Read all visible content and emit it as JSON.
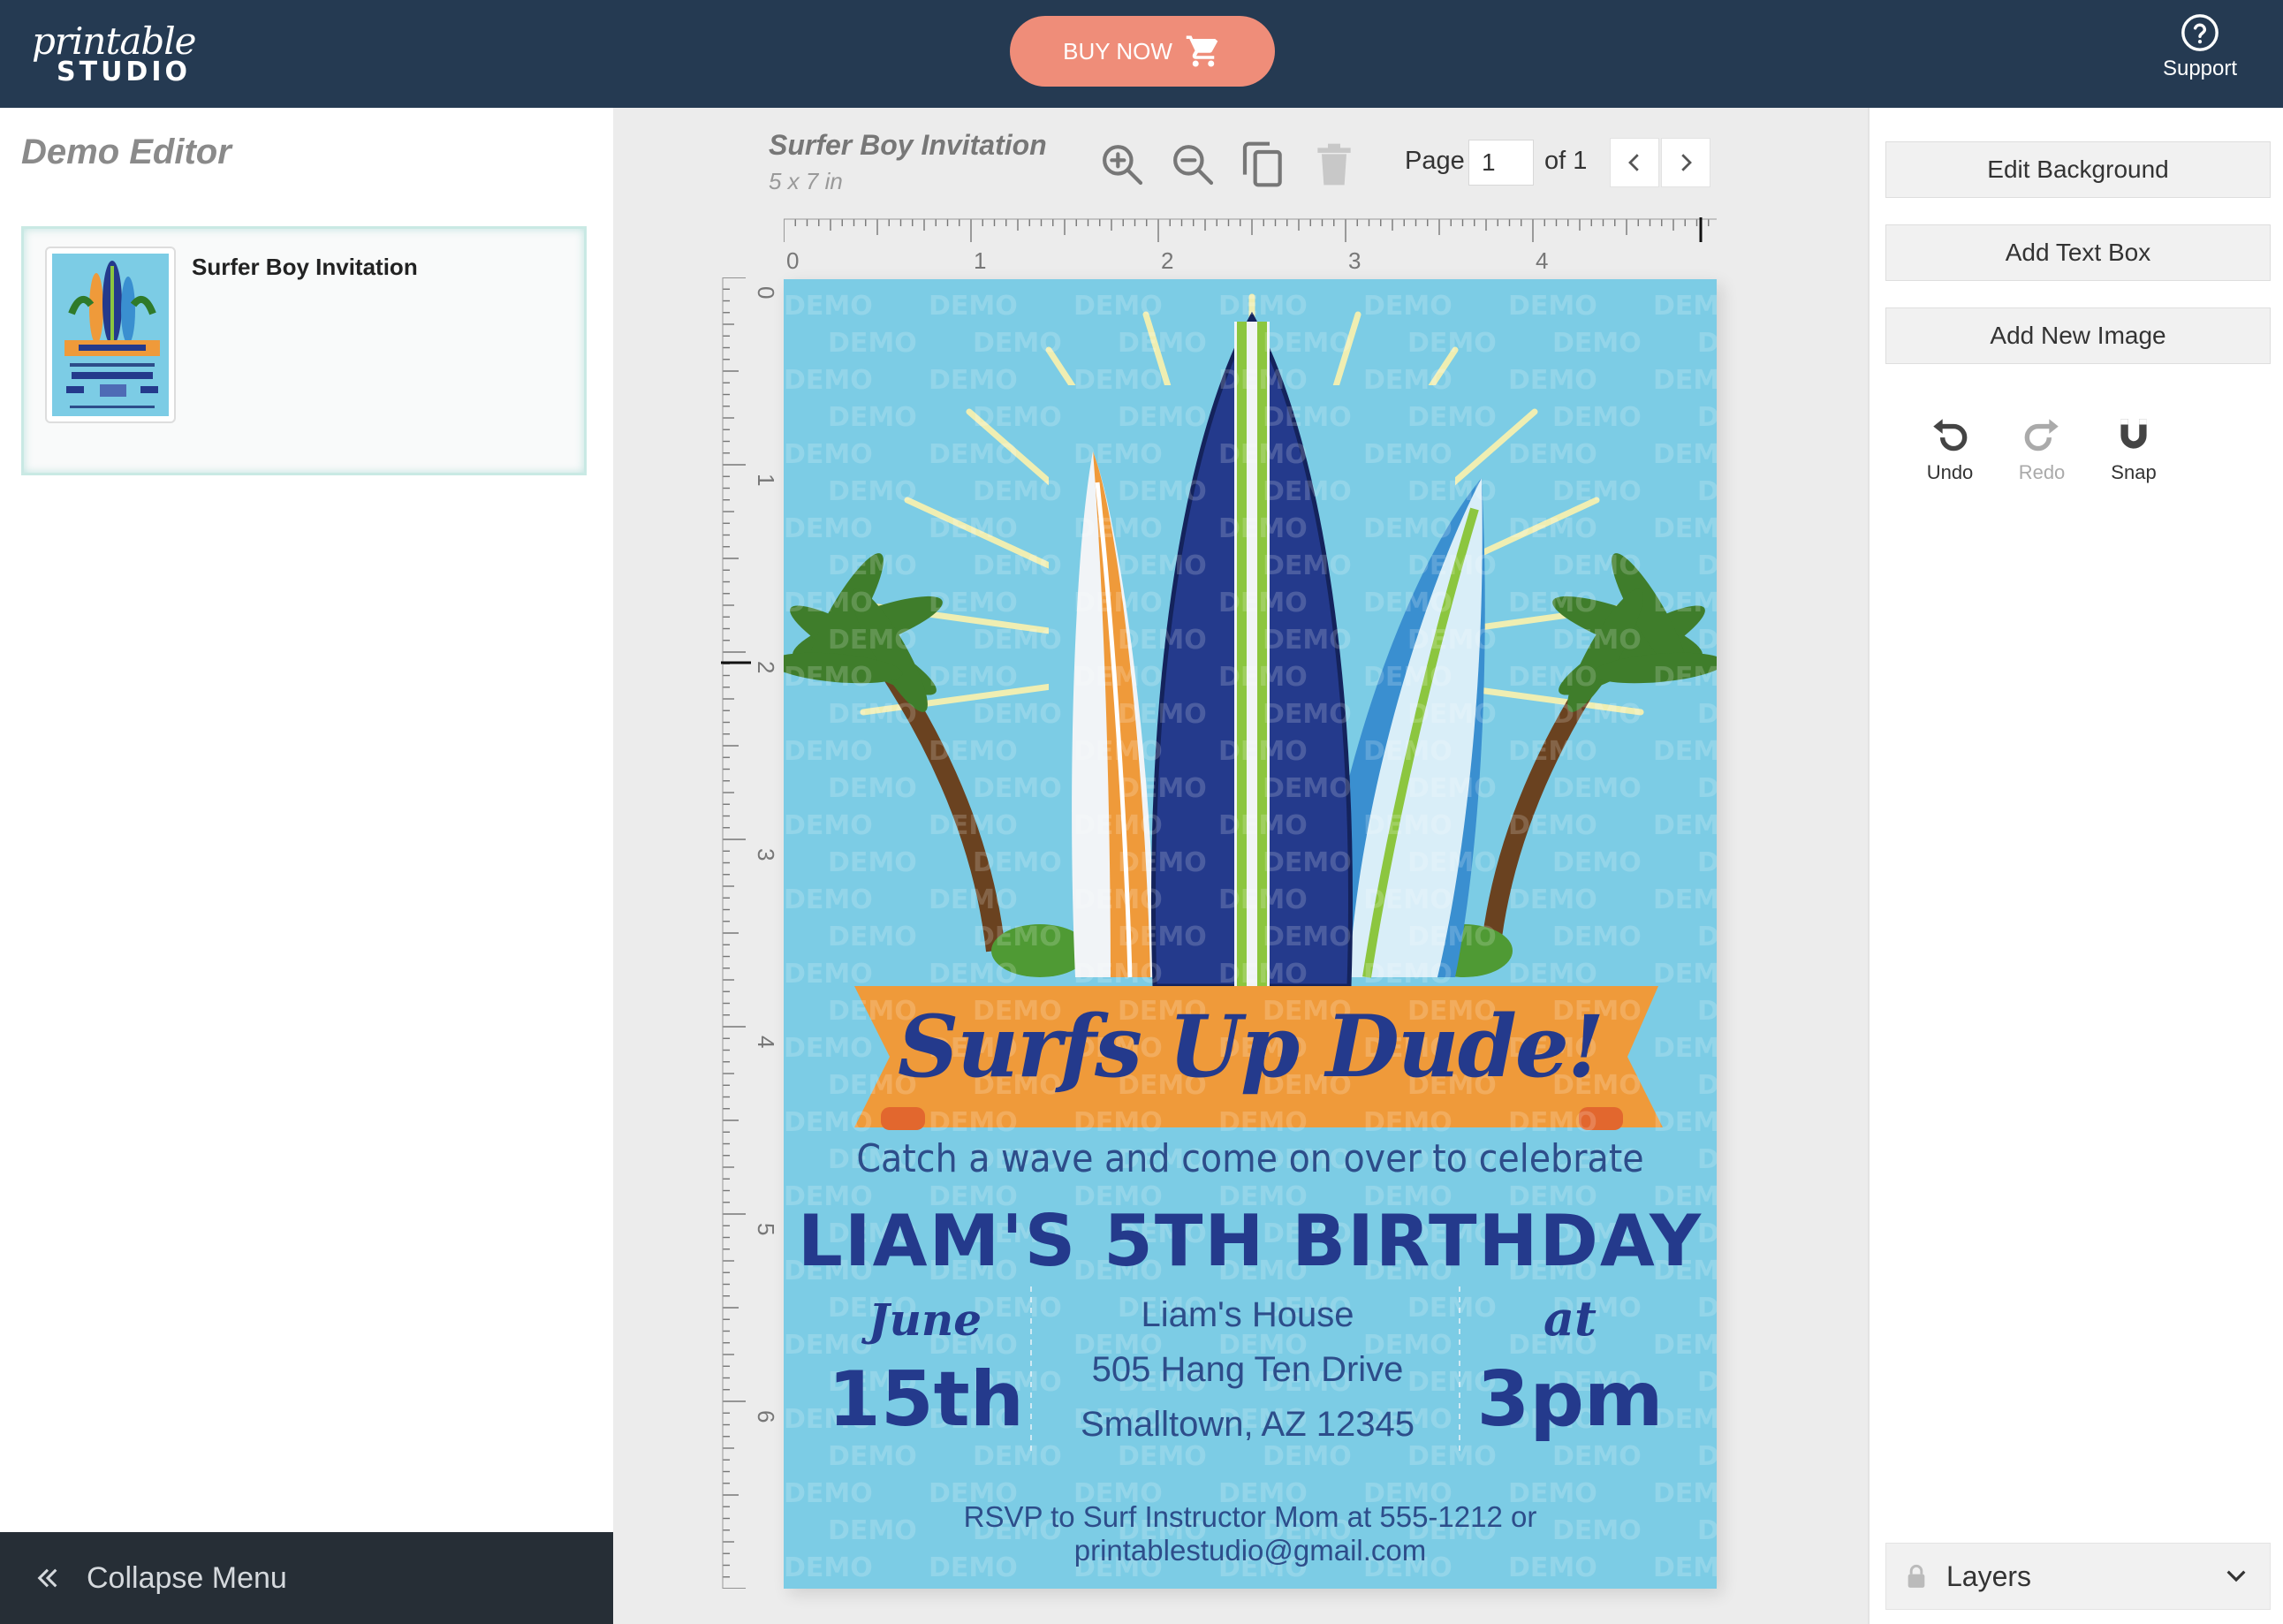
{
  "header": {
    "logo_script": "printable",
    "logo_caps": "STUDIO",
    "buy_label": "BUY NOW",
    "support_label": "Support"
  },
  "left_panel": {
    "title": "Demo Editor",
    "project_name": "Surfer Boy Invitation",
    "collapse_label": "Collapse Menu"
  },
  "document": {
    "title": "Surfer Boy Invitation",
    "size": "5 x 7 in",
    "page_label": "Page",
    "page_value": "1",
    "page_of": "of 1"
  },
  "toolbar": {
    "icons": [
      "zoom-in-icon",
      "zoom-out-icon",
      "duplicate-icon",
      "delete-icon"
    ]
  },
  "rulers": {
    "horizontal_marks": [
      "0",
      "1",
      "2",
      "3",
      "4"
    ],
    "vertical_marks": [
      "0",
      "1",
      "2",
      "3",
      "4",
      "5",
      "6"
    ]
  },
  "invitation": {
    "banner": "Surfs Up Dude!",
    "tagline": "Catch a wave and come on over to celebrate",
    "headline": "LIAM'S 5TH BIRTHDAY",
    "month": "June",
    "day": "15th",
    "venue": "Liam's House",
    "street": "505 Hang Ten Drive",
    "city": "Smalltown, AZ 12345",
    "at": "at",
    "time": "3pm",
    "rsvp": "RSVP to Surf Instructor Mom at 555-1212 or printablestudio@gmail.com",
    "watermark": "DEMO"
  },
  "right_panel": {
    "edit_background": "Edit Background",
    "add_text_box": "Add Text Box",
    "add_new_image": "Add New Image",
    "undo": "Undo",
    "redo": "Redo",
    "snap": "Snap",
    "layers": "Layers"
  },
  "colors": {
    "topbar": "#253a52",
    "buy_button": "#ef8d79",
    "canvas_bg": "#7ccce5",
    "navy": "#243a8c",
    "orange": "#ef9a3a",
    "lime": "#8cc63f"
  }
}
